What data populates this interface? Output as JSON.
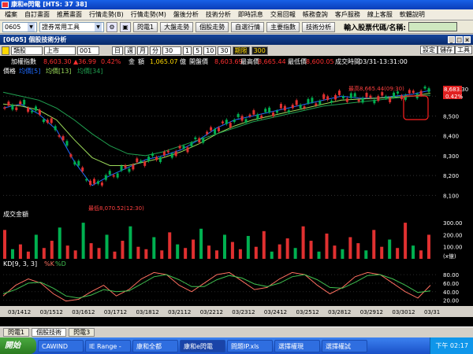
{
  "window": {
    "title": "康和e閃電 [HTS: 37 38]"
  },
  "menu": [
    "檔案",
    "自訂畫面",
    "推薦畫面",
    "行情走勢(B)",
    "行情走勢(M)",
    "盤後分析",
    "技術分析",
    "即時訊息",
    "交易回報",
    "帳務查詢",
    "客戶服務",
    "線上客服",
    "軟體說明"
  ],
  "toolbar": {
    "code": "0605",
    "group": "證券常用工具",
    "buttons": [
      "閃電1",
      "大盤走勢",
      "個股走勢",
      "自選行情",
      "主要指數",
      "技術分析"
    ],
    "stock_input_label": "輸入股票代碼/名稱:"
  },
  "panel": {
    "title": "[0605] 個股技術分析"
  },
  "controls": {
    "type": "類股",
    "market": "上市",
    "code": "001",
    "periods": [
      "日",
      "週",
      "月",
      "分"
    ],
    "minutes": "30",
    "counts": [
      "1",
      "5",
      "10",
      "30"
    ],
    "special": "期限",
    "bars": "300",
    "settings": "設定",
    "save": "儲存",
    "tools": "工具"
  },
  "info": {
    "name": "加權指數",
    "price": "8,603.30",
    "change": "▲36.99",
    "pct": "0.42%",
    "amt_label": "金",
    "amt": "額",
    "amt_value": "1,065.07",
    "ref_label": "億",
    "open_label": "開盤價",
    "open": "8,603.69",
    "high_label": "最高價",
    "high": "8,665.44",
    "low_label": "最低價",
    "low": "8,600.05",
    "time_label": "成交時間",
    "time": "03/31-13:31:00"
  },
  "legend": {
    "label": "價格",
    "ma1": "均價[5]",
    "ma2": "均價[13]",
    "ma3": "均價[34]"
  },
  "annotations": {
    "high_note": "最高8,665.44(09:30)",
    "low_note": "最低8,070.52(12:30)",
    "last_price": "8,683.30",
    "last_pct": "0.42%"
  },
  "volume": {
    "label": "成交金額",
    "unit": "(x億)"
  },
  "kd": {
    "label": "KD[9, 3, 3]",
    "k_label": "%K",
    "d_label": "%D"
  },
  "sheets": [
    "閃電1",
    "個股技術",
    "閃電3"
  ],
  "taskbar": {
    "start": "開始",
    "tasks": [
      "CAWIND",
      "IE Range -",
      "康和全都",
      "康和e閃電",
      "問題IP.xls",
      "選擇權現",
      "選擇權試"
    ],
    "clock": "下午 02:17"
  },
  "colors": {
    "up": "#e03030",
    "down": "#00b050",
    "ma5": "#1f6bff",
    "ma13": "#9cdb5a",
    "ma34": "#20a050",
    "k": "#ff7060",
    "d": "#40c050"
  },
  "chart_data": [
    {
      "type": "line",
      "title": "",
      "series": [
        {
          "name": "均價[5]",
          "values": [
            8540,
            8560,
            8510,
            8430,
            8270,
            8150,
            8200,
            8240,
            8280,
            8300,
            8330,
            8380,
            8440,
            8480,
            8500,
            8520,
            8540,
            8560,
            8580,
            8600,
            8590,
            8590,
            8600,
            8610,
            8630
          ]
        },
        {
          "name": "均價[13]",
          "values": [
            8560,
            8550,
            8530,
            8480,
            8380,
            8290,
            8250,
            8250,
            8270,
            8290,
            8320,
            8360,
            8410,
            8450,
            8480,
            8500,
            8520,
            8540,
            8560,
            8580,
            8585,
            8590,
            8595,
            8600,
            8615
          ]
        },
        {
          "name": "均價[34]",
          "values": [
            8620,
            8600,
            8580,
            8540,
            8480,
            8410,
            8350,
            8310,
            8300,
            8320,
            8350,
            8380,
            8410,
            8440,
            8470,
            8490,
            8510,
            8530,
            8550,
            8560,
            8570,
            8580,
            8590,
            8600,
            8605
          ]
        }
      ],
      "x": [
        "03/14",
        "12",
        "03/15",
        "12",
        "03/16",
        "12",
        "03/17",
        "12",
        "03/18",
        "12",
        "03/21",
        "12",
        "03/22",
        "12",
        "03/23",
        "12",
        "03/24",
        "12",
        "03/25",
        "12",
        "03/28",
        "12",
        "03/29",
        "12",
        "03/30",
        "12",
        "03/31"
      ],
      "ylim": [
        8050,
        8700
      ],
      "yticks": [
        8100,
        8200,
        8300,
        8400,
        8500,
        8600
      ],
      "grid": false
    },
    {
      "type": "bar",
      "title": "成交金額",
      "ylabel": "(x億)",
      "ylim": [
        0,
        340
      ],
      "yticks": [
        100,
        200,
        300
      ],
      "values": [
        240,
        80,
        120,
        60,
        200,
        90,
        150,
        260,
        110,
        70,
        300,
        130,
        90,
        200,
        60,
        150,
        270,
        100,
        80,
        180,
        70,
        220,
        120,
        90,
        160,
        250,
        110,
        70,
        200,
        140,
        80,
        190,
        100,
        230,
        60,
        120,
        170,
        90,
        270,
        150,
        60,
        210,
        110,
        80,
        180,
        130,
        70,
        240,
        100,
        160,
        90,
        300,
        110,
        70,
        200
      ]
    },
    {
      "type": "line",
      "title": "KD[9, 3, 3]",
      "ylim": [
        10,
        95
      ],
      "yticks": [
        20,
        40,
        60,
        80
      ],
      "series": [
        {
          "name": "%K",
          "values": [
            30,
            55,
            70,
            60,
            35,
            18,
            22,
            40,
            55,
            30,
            45,
            70,
            85,
            80,
            55,
            40,
            60,
            80,
            85,
            65,
            45,
            50,
            70,
            85,
            80,
            55,
            35,
            50,
            75,
            85,
            80,
            60,
            40,
            25,
            55
          ]
        },
        {
          "name": "%D",
          "values": [
            35,
            45,
            60,
            62,
            48,
            30,
            25,
            32,
            45,
            40,
            42,
            58,
            75,
            80,
            68,
            52,
            52,
            68,
            78,
            72,
            58,
            52,
            60,
            75,
            80,
            68,
            50,
            48,
            62,
            78,
            80,
            70,
            55,
            38,
            42
          ]
        }
      ],
      "grid": false
    }
  ]
}
